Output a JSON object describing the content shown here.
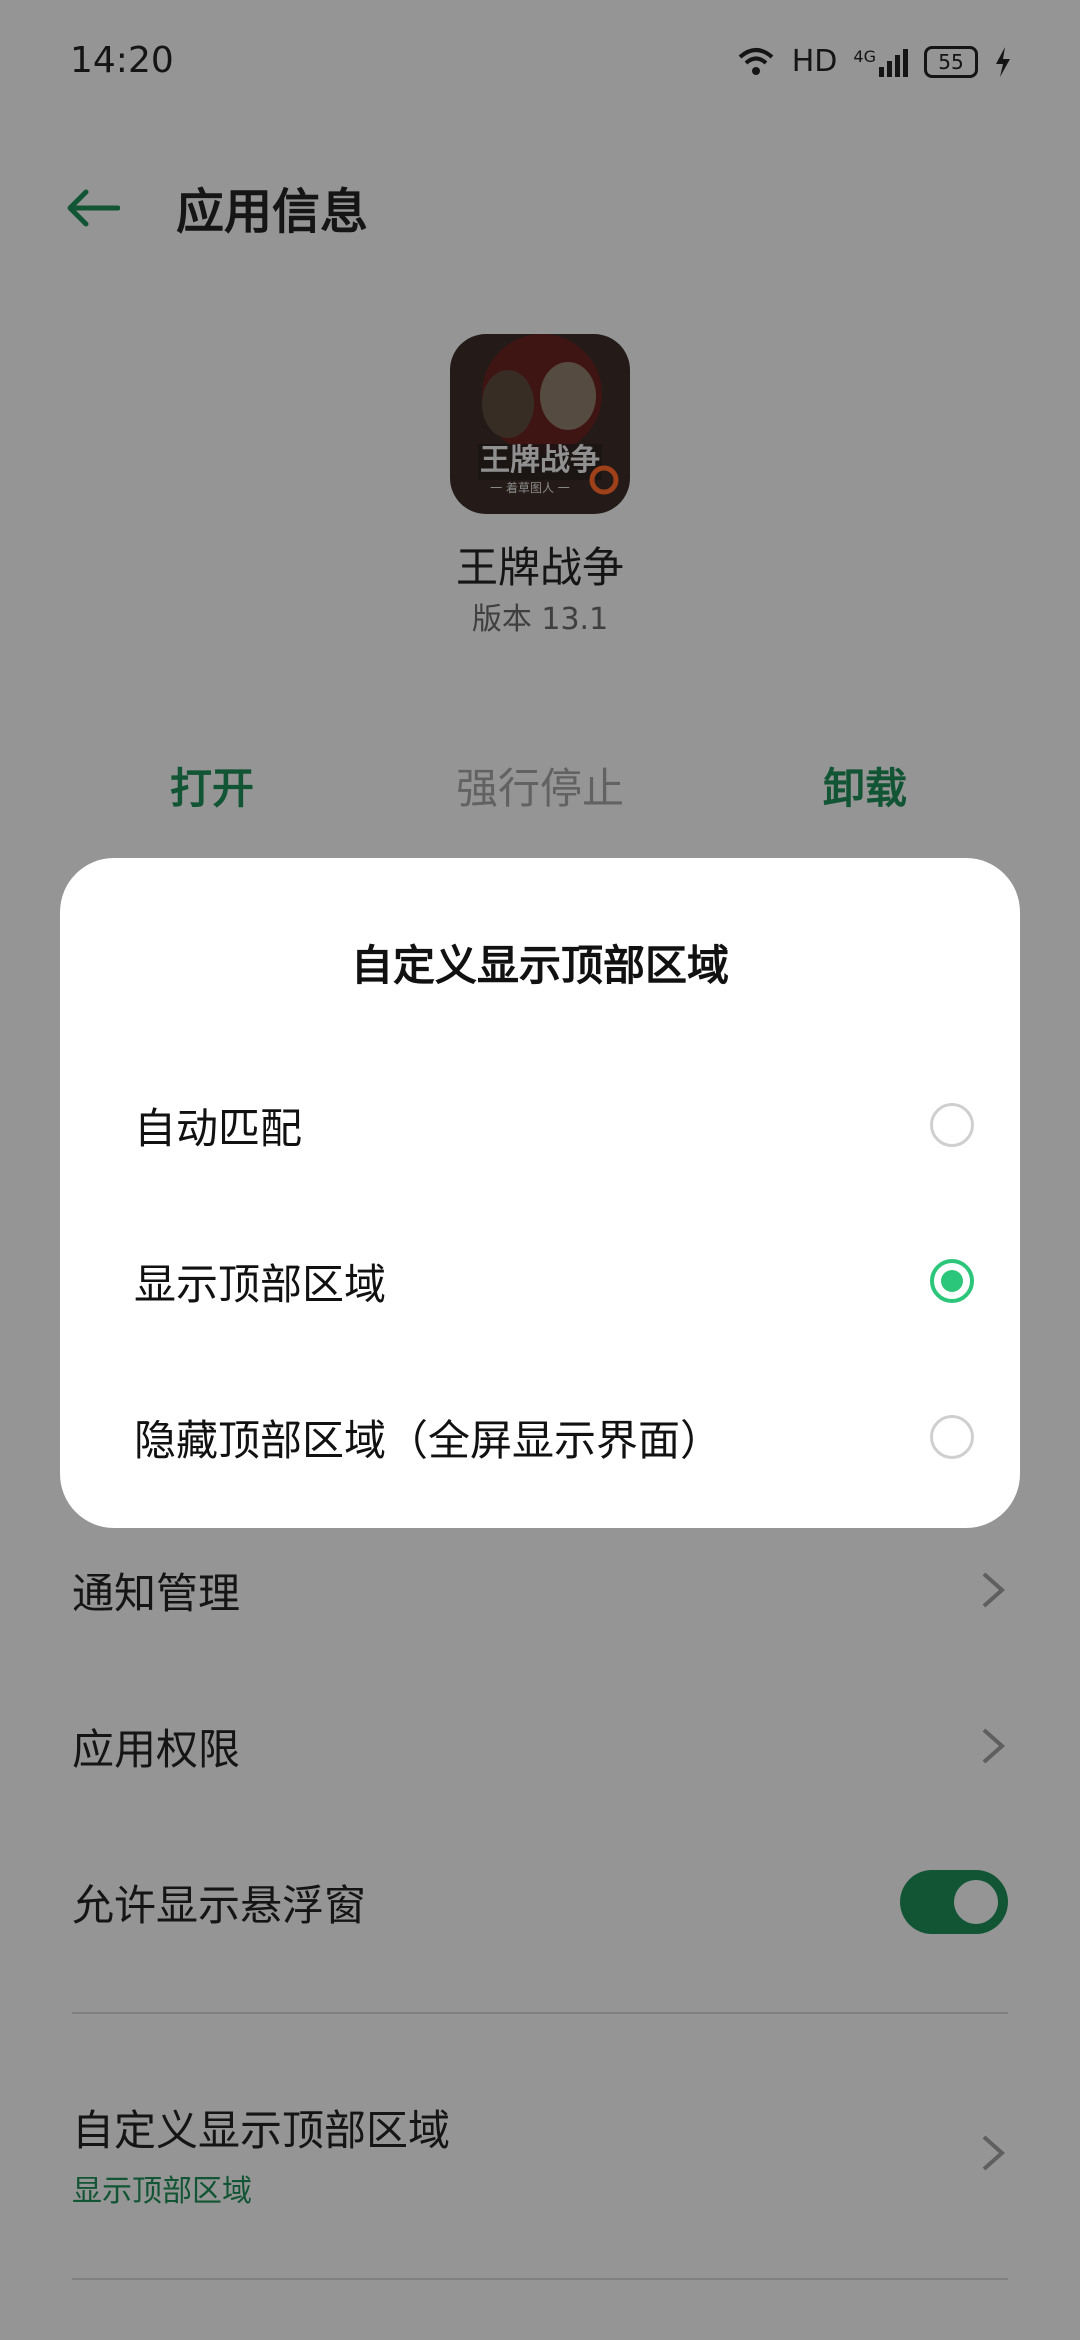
{
  "status_bar": {
    "time": "14:20",
    "network": "HD",
    "signal_label": "4G",
    "battery": "55",
    "icons": [
      "wifi-icon",
      "signal-icon",
      "battery-icon",
      "charging-icon"
    ]
  },
  "app_bar": {
    "title": "应用信息",
    "back_icon": "arrow-left-icon"
  },
  "app": {
    "name": "王牌战争",
    "version": "版本 13.1",
    "icon_caption": "王牌战争",
    "icon_subcaption": "一 着草图人 一"
  },
  "actions": {
    "open": "打开",
    "force_stop": "强行停止",
    "uninstall": "卸载"
  },
  "settings": {
    "notifications": "通知管理",
    "permissions": "应用权限",
    "floating_window": "允许显示悬浮窗",
    "floating_window_enabled": true,
    "custom_top_area": "自定义显示顶部区域",
    "custom_top_area_value": "显示顶部区域"
  },
  "dialog": {
    "title": "自定义显示顶部区域",
    "options": [
      {
        "label": "自动匹配",
        "selected": false
      },
      {
        "label": "显示顶部区域",
        "selected": true
      },
      {
        "label": "隐藏顶部区域（全屏显示界面）",
        "selected": false
      }
    ]
  },
  "colors": {
    "accent": "#1d8a55",
    "radio_selected": "#2cc67b",
    "scrim": "rgba(0,0,0,0.38)"
  }
}
